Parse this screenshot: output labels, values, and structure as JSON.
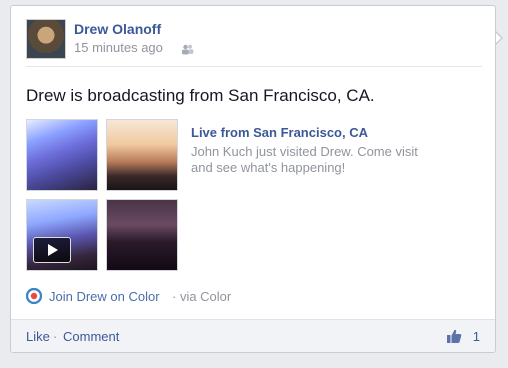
{
  "post": {
    "author": "Drew Olanoff",
    "time": "15 minutes ago",
    "audience_icon": "friends-icon",
    "status": "Drew is broadcasting from San Francisco, CA.",
    "attachment": {
      "title": "Live from San Francisco, CA",
      "description": "John Kuch just visited Drew. Come visit and see what's happening!",
      "thumbnails": [
        "city-photo",
        "sunset-photo",
        "video-thumbnail",
        "dark-photo"
      ],
      "video_icon": "play-icon"
    },
    "source": {
      "icon": "color-app-icon",
      "link": "Join Drew on Color",
      "via": " · via Color"
    }
  },
  "footer": {
    "like_label": "Like",
    "separator": "·",
    "comment_label": "Comment",
    "like_icon": "thumbs-up-icon",
    "like_count": "1"
  },
  "colors": {
    "brand_blue": "#3b5998",
    "muted_gray": "#90949c",
    "footer_bg": "#f2f3f7"
  }
}
